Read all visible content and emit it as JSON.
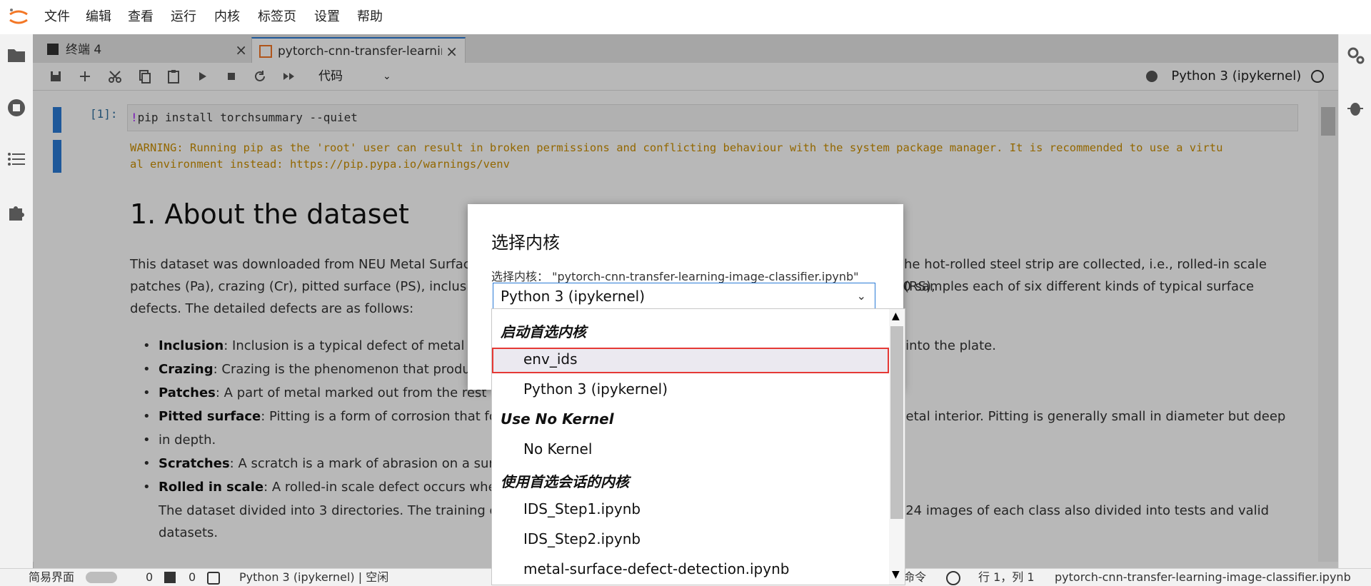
{
  "menu": [
    "文件",
    "编辑",
    "查看",
    "运行",
    "内核",
    "标签页",
    "设置",
    "帮助"
  ],
  "tabs": {
    "terminal": "终端 4",
    "notebook": "pytorch-cnn-transfer-learnin",
    "close": "×"
  },
  "toolbar": {
    "cell_type": "代码",
    "kernel": "Python 3 (ipykernel)"
  },
  "cell1": {
    "prompt": "[1]:",
    "code_bang": "!",
    "code_rest": "pip install torchsummary --quiet",
    "warning_line1": "WARNING: Running pip as the 'root' user can result in broken permissions and conflicting behaviour with the system package manager. It is recommended to use a virtu",
    "warning_line2": "al environment instead: https://pip.pypa.io/warnings/venv"
  },
  "markdown": {
    "heading": "1. About the dataset",
    "para_line1": "This dataset was downloaded from NEU Metal Surface",
    "para_line1b": "he hot-rolled steel strip are collected, i.e., rolled-in scale (RS),",
    "para_line2": "patches (Pa), crazing (Cr), pitted surface (PS), inclusion (",
    "para_line2b": "00 samples each of six different kinds of typical surface",
    "para_line3": "defects. The detailed defects are as follows:",
    "bullets": [
      {
        "term": "Inclusion",
        "text": ": Inclusion is a typical defect of metal surf",
        "tail": "d into the plate."
      },
      {
        "term": "Crazing",
        "text": ": Crazing is the phenomenon that produce",
        "tail": ""
      },
      {
        "term": "Patches",
        "text": ": A part of metal marked out from the rest by a",
        "tail": ""
      },
      {
        "term": "Pitted surface",
        "text": ": Pitting is a form of corrosion that focu",
        "tail": "metal interior. Pitting is generally small in diameter but deep"
      },
      {
        "term": "Scratches",
        "text": ": A scratch is a mark of abrasion on a surface",
        "tail": ""
      },
      {
        "term": "Rolled in scale",
        "text": ": A rolled-in scale defect occurs when th",
        "tail": ""
      }
    ],
    "bullet_cont": "in depth.",
    "divided_line1": "The dataset divided into 3 directories. The training dire",
    "divided_line1b": "est 24 images of each class also divided into tests and valid",
    "divided_line2": "datasets."
  },
  "dialog": {
    "title": "选择内核",
    "label": "选择内核：  \"pytorch-cnn-transfer-learning-image-classifier.ipynb\"",
    "selected": "Python 3 (ipykernel)"
  },
  "dropdown": {
    "group1": "启动首选内核",
    "opt_env": "env_ids",
    "opt_py3": "Python 3 (ipykernel)",
    "group2": "Use No Kernel",
    "opt_none": "No Kernel",
    "group3": "使用首选会话的内核",
    "opt_s1": "IDS_Step1.ipynb",
    "opt_s2": "IDS_Step2.ipynb",
    "opt_metal": "metal-surface-defect-detection.ipynb"
  },
  "statusbar": {
    "simple": "简易界面",
    "count1": "0",
    "count2": "0",
    "kernel": "Python 3 (ipykernel) | 空闲",
    "cmd": "命令",
    "pos": "行 1，列 1",
    "file": "pytorch-cnn-transfer-learning-image-classifier.ipynb"
  },
  "colors": {
    "accent": "#2a7ad6",
    "warning": "#cc8f00",
    "selected_border": "#e53935"
  }
}
